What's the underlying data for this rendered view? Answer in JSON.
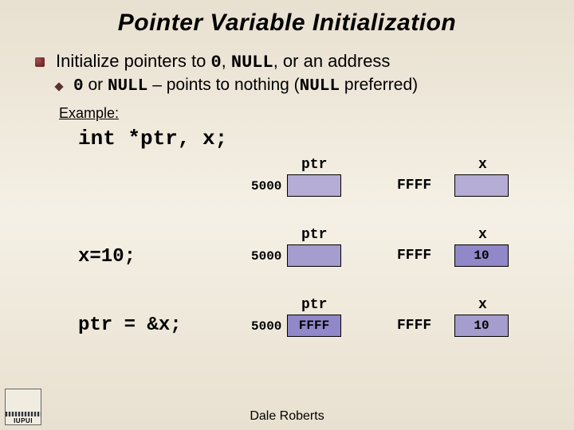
{
  "title": "Pointer Variable Initialization",
  "bullets": {
    "main": "Initialize pointers to ",
    "main_code1": "0",
    "main_mid": ", ",
    "main_code2": "NULL",
    "main_tail": ", or an address",
    "sub_code1": "0",
    "sub_mid1": " or ",
    "sub_code2": "NULL",
    "sub_mid2": " – points to nothing (",
    "sub_code3": "NULL",
    "sub_tail": " preferred)"
  },
  "example_label": "Example:",
  "decl": "int *ptr, x;",
  "rows": [
    {
      "stmt": "",
      "ptr_label": "ptr",
      "ptr_addr": "5000",
      "ptr_val": "",
      "gap_addr": "FFFF",
      "x_label": "x",
      "x_val": ""
    },
    {
      "stmt": "x=10;",
      "ptr_label": "ptr",
      "ptr_addr": "5000",
      "ptr_val": "",
      "gap_addr": "FFFF",
      "x_label": "x",
      "x_val": "10"
    },
    {
      "stmt": "ptr = &x;",
      "ptr_label": "ptr",
      "ptr_addr": "5000",
      "ptr_val": "FFFF",
      "gap_addr": "FFFF",
      "x_label": "x",
      "x_val": "10"
    }
  ],
  "footer": "Dale Roberts",
  "logo": "IUPUI"
}
